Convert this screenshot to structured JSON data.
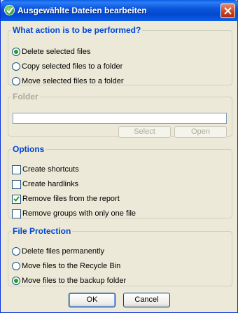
{
  "window": {
    "title": "Ausgewählte Dateien bearbeiten"
  },
  "action_group": {
    "legend": "What action is to be performed?",
    "options": [
      {
        "label": "Delete selected files",
        "selected": true
      },
      {
        "label": "Copy selected files to a folder",
        "selected": false
      },
      {
        "label": "Move selected files to a folder",
        "selected": false
      }
    ]
  },
  "folder_group": {
    "legend": "Folder",
    "path_value": "",
    "select_label": "Select",
    "open_label": "Open",
    "enabled": false
  },
  "options_group": {
    "legend": "Options",
    "items": [
      {
        "label": "Create shortcuts",
        "checked": false
      },
      {
        "label": "Create hardlinks",
        "checked": false
      },
      {
        "label": "Remove files from the report",
        "checked": true
      },
      {
        "label": "Remove groups with only one file",
        "checked": false
      }
    ]
  },
  "protection_group": {
    "legend": "File Protection",
    "options": [
      {
        "label": "Delete files permanently",
        "selected": false
      },
      {
        "label": "Move files to the Recycle Bin",
        "selected": false
      },
      {
        "label": "Move files to the backup folder",
        "selected": true
      }
    ]
  },
  "buttons": {
    "ok": "OK",
    "cancel": "Cancel"
  },
  "colors": {
    "accent": "#0046d5",
    "titlebar": "#0b56dc",
    "face": "#ece9d8"
  }
}
